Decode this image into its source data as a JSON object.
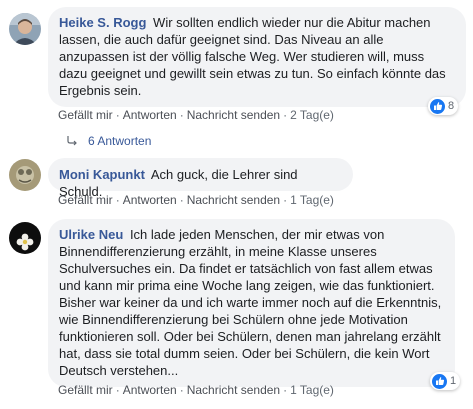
{
  "comments": [
    {
      "author": "Heike S. Rogg",
      "text": "Wir sollten endlich wieder nur die Abitur machen lassen, die auch dafür geeignet sind. Das Niveau an alle anzupassen ist der völlig falsche Weg. Wer studieren will, muss dazu geeignet und gewillt sein etwas zu tun. So einfach könnte das Ergebnis sein.",
      "actions": {
        "like": "Gefällt mir",
        "reply": "Antworten",
        "message": "Nachricht senden",
        "time": "2 Tag(e)"
      },
      "reaction_count": "8"
    },
    {
      "author": "Moni Kapunkt",
      "text": "Ach guck, die Lehrer sind Schuld.",
      "actions": {
        "like": "Gefällt mir",
        "reply": "Antworten",
        "message": "Nachricht senden",
        "time": "1 Tag(e)"
      }
    },
    {
      "author": "Ulrike Neu",
      "text": "Ich lade jeden Menschen, der mir etwas von Binnendifferenzierung erzählt, in meine Klasse unseres Schulversuches ein. Da findet er tatsächlich von fast allem etwas und kann mir prima eine Woche lang zeigen, wie das funktioniert. Bisher war keiner da und ich warte immer noch auf die Erkenntnis, wie Binnendifferenzierung bei Schülern ohne jede Motivation funktionieren soll. Oder bei Schülern, denen man jahrelang erzählt hat, dass sie total dumm seien. Oder bei Schülern, die kein Wort Deutsch verstehen...",
      "actions": {
        "like": "Gefällt mir",
        "reply": "Antworten",
        "message": "Nachricht senden",
        "time": "1 Tag(e)"
      },
      "reaction_count": "1"
    }
  ],
  "replies_label": "6 Antworten",
  "colors": {
    "author": "#385898",
    "bubble": "#f2f3f5",
    "like": "#1877f2"
  }
}
